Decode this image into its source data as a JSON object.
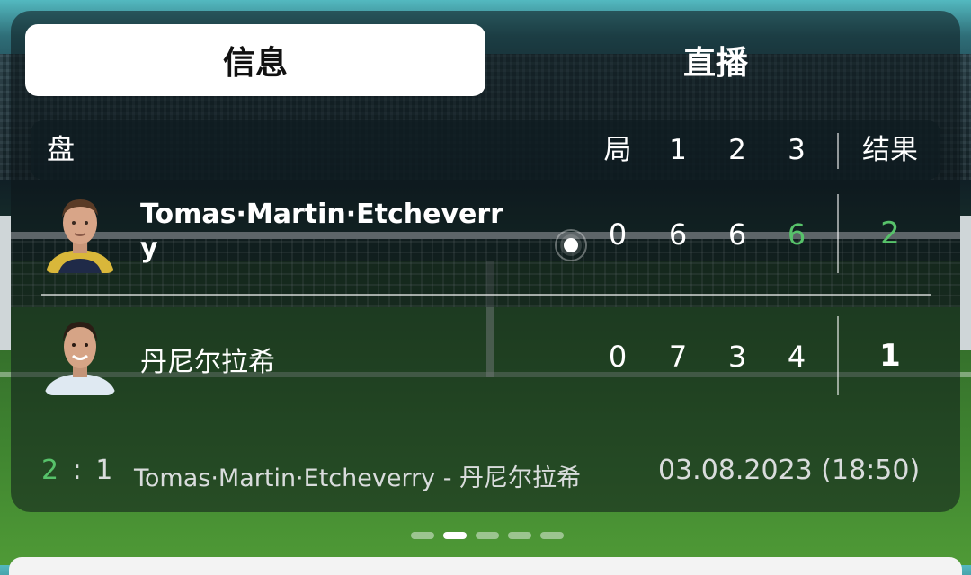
{
  "tabs": [
    {
      "label": "信息",
      "active": true
    },
    {
      "label": "直播",
      "active": false
    }
  ],
  "table": {
    "header": {
      "set_label": "盘",
      "games_label": "局",
      "set_cols": [
        "1",
        "2",
        "3"
      ],
      "result_label": "结果"
    },
    "rows": [
      {
        "player": "Tomas·Martin·Etcheverr\ny",
        "serving": true,
        "games": "0",
        "sets": [
          "6",
          "6",
          "6"
        ],
        "result": "2"
      },
      {
        "player": "丹尼尔拉希",
        "serving": false,
        "games": "0",
        "sets": [
          "7",
          "3",
          "4"
        ],
        "result": "1"
      }
    ]
  },
  "footer": {
    "score_home": "2",
    "score_sep": ":",
    "score_away": "1",
    "match": "Tomas·Martin·Etcheverry - 丹尼尔拉希",
    "datetime": "03.08.2023 (18:50)"
  },
  "pager": {
    "count": 5,
    "active_index": 1
  },
  "colors": {
    "accent_green": "#57c26a",
    "active_tab_bg": "#ffffff"
  }
}
